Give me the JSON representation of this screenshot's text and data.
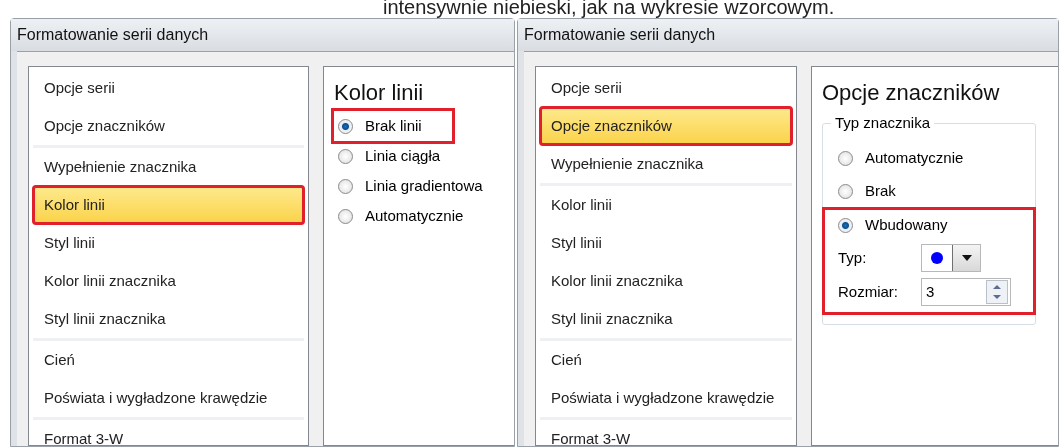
{
  "caption": "intensywnie niebieski, jak na wykresie wzorcowym.",
  "dialogs": [
    {
      "title": "Formatowanie serii danych",
      "groups": [
        [
          {
            "label": "Opcje serii",
            "selected": false,
            "highlighted": false
          },
          {
            "label": "Opcje znaczników",
            "selected": false,
            "highlighted": false
          }
        ],
        [
          {
            "label": "Wypełnienie znacznika",
            "selected": false,
            "highlighted": false
          },
          {
            "label": "Kolor linii",
            "selected": true,
            "highlighted": true
          },
          {
            "label": "Styl linii",
            "selected": false,
            "highlighted": false
          },
          {
            "label": "Kolor linii znacznika",
            "selected": false,
            "highlighted": false
          },
          {
            "label": "Styl linii znacznika",
            "selected": false,
            "highlighted": false
          }
        ],
        [
          {
            "label": "Cień",
            "selected": false,
            "highlighted": false
          },
          {
            "label": "Poświata i wygładzone krawędzie",
            "selected": false,
            "highlighted": false
          }
        ],
        [
          {
            "label": "Format 3-W",
            "selected": false,
            "highlighted": false
          }
        ]
      ],
      "panel": {
        "kind": "radio_list",
        "heading": "Kolor linii",
        "options": [
          {
            "label": "Brak linii",
            "selected": true,
            "highlighted": true
          },
          {
            "label": "Linia ciągła",
            "selected": false,
            "highlighted": false
          },
          {
            "label": "Linia gradientowa",
            "selected": false,
            "highlighted": false
          },
          {
            "label": "Automatycznie",
            "selected": false,
            "highlighted": false
          }
        ]
      }
    },
    {
      "title": "Formatowanie serii danych",
      "groups": [
        [
          {
            "label": "Opcje serii",
            "selected": false,
            "highlighted": false
          },
          {
            "label": "Opcje znaczników",
            "selected": true,
            "highlighted": true
          },
          {
            "label": "Wypełnienie znacznika",
            "selected": false,
            "highlighted": false
          }
        ],
        [
          {
            "label": "Kolor linii",
            "selected": false,
            "highlighted": false
          },
          {
            "label": "Styl linii",
            "selected": false,
            "highlighted": false
          },
          {
            "label": "Kolor linii znacznika",
            "selected": false,
            "highlighted": false
          },
          {
            "label": "Styl linii znacznika",
            "selected": false,
            "highlighted": false
          }
        ],
        [
          {
            "label": "Cień",
            "selected": false,
            "highlighted": false
          },
          {
            "label": "Poświata i wygładzone krawędzie",
            "selected": false,
            "highlighted": false
          }
        ],
        [
          {
            "label": "Format 3-W",
            "selected": false,
            "highlighted": false
          }
        ]
      ],
      "panel": {
        "kind": "marker_options",
        "heading": "Opcje znaczników",
        "group_label": "Typ znacznika",
        "options": [
          {
            "label": "Automatycznie",
            "selected": false
          },
          {
            "label": "Brak",
            "selected": false
          },
          {
            "label": "Wbudowany",
            "selected": true
          }
        ],
        "builtin_highlighted": true,
        "type_label": "Typ:",
        "size_label": "Rozmiar:",
        "size_value": "3"
      }
    }
  ]
}
